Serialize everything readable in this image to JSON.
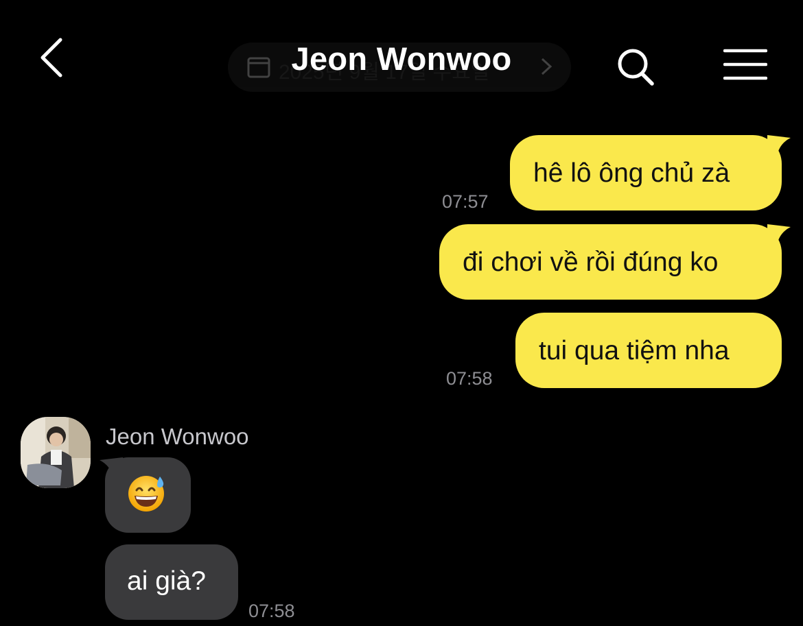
{
  "header": {
    "title": "Jeon Wonwoo",
    "date_pill_text": "2025년 9월 17일 수요일",
    "back_icon": "chevron-left-icon",
    "search_icon": "search-icon",
    "menu_icon": "hamburger-menu-icon"
  },
  "colors": {
    "background": "#000000",
    "outgoing_bubble": "#fae84c",
    "incoming_bubble": "#3a3a3c",
    "timestamp": "#8e8e93"
  },
  "messages": {
    "outgoing": [
      {
        "text": "hê lô ông chủ zà",
        "time": "07:57"
      },
      {
        "text": "đi chơi về rồi đúng ko",
        "time": ""
      },
      {
        "text": "tui qua tiệm nha",
        "time": "07:58"
      }
    ],
    "incoming": {
      "sender": "Jeon Wonwoo",
      "items": [
        {
          "text": "",
          "emoji": "grinning-face-with-sweat-icon"
        },
        {
          "text": "ai già?",
          "time": "07:58"
        }
      ]
    }
  }
}
